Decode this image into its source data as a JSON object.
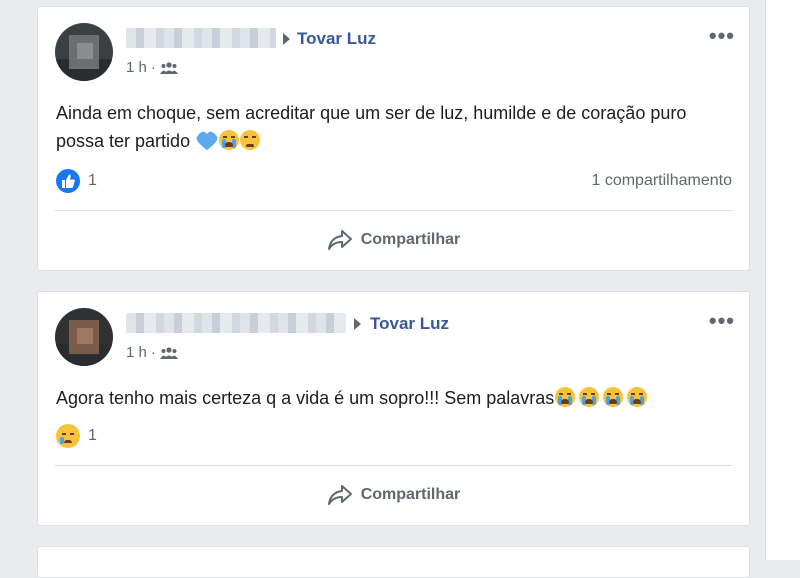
{
  "posts": [
    {
      "group_name": "Tovar Luz",
      "time": "1 h",
      "separator": "·",
      "audience_icon": "group-icon",
      "text": "Ainda em choque, sem acreditar que um ser de luz, humilde e de coração puro possa ter partido",
      "emojis": [
        "blue-heart",
        "loudly-crying-face",
        "sad-face"
      ],
      "reaction_icon": "like-icon",
      "reaction_count": "1",
      "shares_text": "1 compartilhamento",
      "share_label": "Compartilhar"
    },
    {
      "group_name": "Tovar Luz",
      "time": "1 h",
      "separator": "·",
      "audience_icon": "group-icon",
      "text": "Agora tenho mais certeza q a vida é um sopro!!! Sem palavras",
      "emojis": [
        "loudly-crying-face",
        "loudly-crying-face",
        "loudly-crying-face",
        "loudly-crying-face"
      ],
      "reaction_icon": "sad-reaction-icon",
      "reaction_count": "1",
      "share_label": "Compartilhar"
    }
  ],
  "colors": {
    "page_bg": "#e9ebee",
    "link": "#385898",
    "like_blue": "#1877f2",
    "secondary_text": "#606770",
    "emoji_yellow": "#f7c23c"
  }
}
